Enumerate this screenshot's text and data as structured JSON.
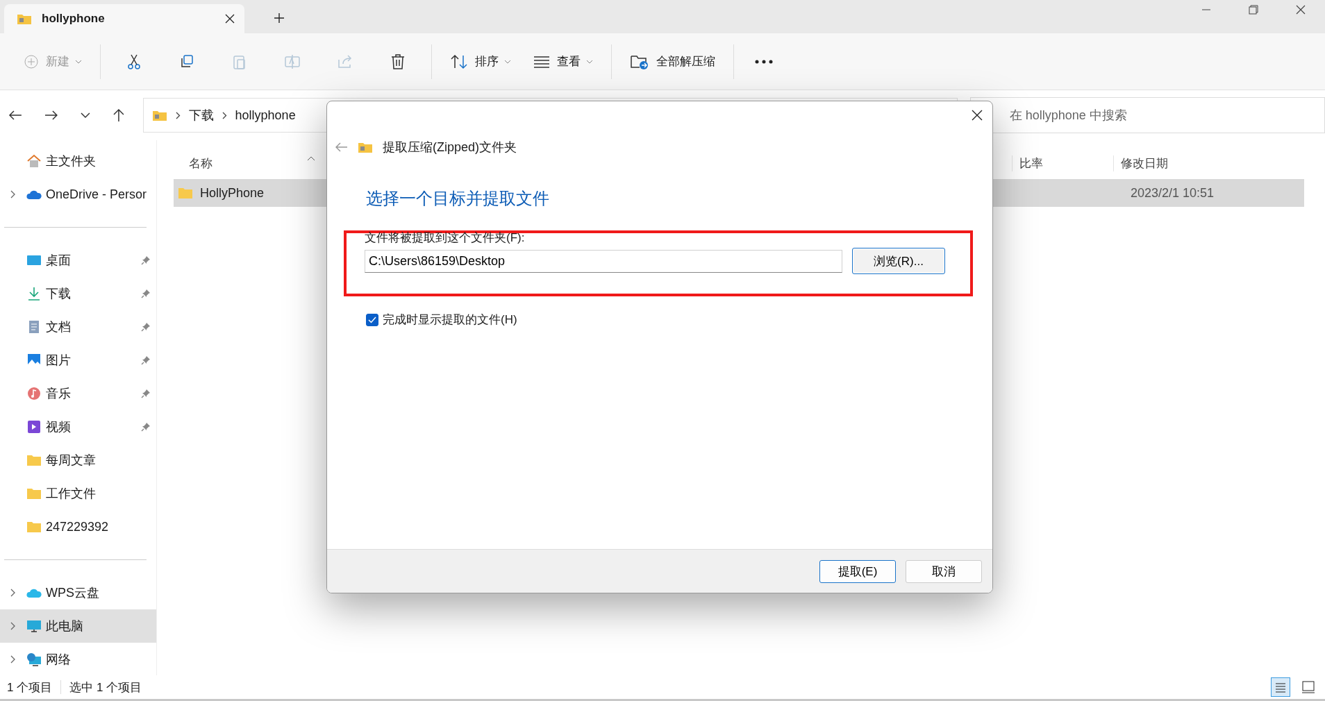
{
  "tab": {
    "title": "hollyphone"
  },
  "toolbar": {
    "new": {
      "label": "新建",
      "disabled": true
    },
    "actions": [
      {
        "kind": "cut",
        "disabled": false
      },
      {
        "kind": "copy",
        "disabled": false
      },
      {
        "kind": "paste",
        "disabled": true
      },
      {
        "kind": "rename",
        "disabled": true
      },
      {
        "kind": "share",
        "disabled": true
      },
      {
        "kind": "delete",
        "disabled": false
      }
    ],
    "sort": {
      "label": "排序"
    },
    "view": {
      "label": "查看"
    },
    "extract_all": {
      "label": "全部解压缩"
    }
  },
  "address": {
    "crumbs": [
      "下载",
      "hollyphone"
    ]
  },
  "search": {
    "placeholder": "在 hollyphone 中搜索"
  },
  "sidebar": {
    "groups": [
      [
        {
          "label": "主文件夹",
          "expandable": false,
          "pinned": false,
          "selected": false
        },
        {
          "label": "OneDrive - Persor",
          "expandable": true,
          "pinned": false,
          "selected": false
        }
      ],
      [
        {
          "label": "桌面",
          "expandable": false,
          "pinned": true,
          "selected": false
        },
        {
          "label": "下载",
          "expandable": false,
          "pinned": true,
          "selected": false
        },
        {
          "label": "文档",
          "expandable": false,
          "pinned": true,
          "selected": false
        },
        {
          "label": "图片",
          "expandable": false,
          "pinned": true,
          "selected": false
        },
        {
          "label": "音乐",
          "expandable": false,
          "pinned": true,
          "selected": false
        },
        {
          "label": "视频",
          "expandable": false,
          "pinned": true,
          "selected": false
        },
        {
          "label": "每周文章",
          "expandable": false,
          "pinned": false,
          "selected": false
        },
        {
          "label": "工作文件",
          "expandable": false,
          "pinned": false,
          "selected": false
        },
        {
          "label": "247229392",
          "expandable": false,
          "pinned": false,
          "selected": false
        }
      ],
      [
        {
          "label": "WPS云盘",
          "expandable": true,
          "pinned": false,
          "selected": false
        },
        {
          "label": "此电脑",
          "expandable": true,
          "pinned": false,
          "selected": true
        },
        {
          "label": "网络",
          "expandable": true,
          "pinned": false,
          "selected": false
        }
      ]
    ]
  },
  "table": {
    "columns": [
      "名称",
      "比率",
      "修改日期"
    ],
    "rows": [
      {
        "name": "HollyPhone",
        "date": "2023/2/1 10:51",
        "selected": true
      }
    ]
  },
  "status_bar": {
    "count": "1 个项目",
    "selection": "选中 1 个项目",
    "views": [
      {
        "kind": "details",
        "selected": true
      },
      {
        "kind": "tiles",
        "selected": false
      }
    ]
  },
  "dialog": {
    "title": "提取压缩(Zipped)文件夹",
    "heading": "选择一个目标并提取文件",
    "field_label": "文件将被提取到这个文件夹(F):",
    "path": "C:\\Users\\86159\\Desktop",
    "browse": "浏览(R)...",
    "show_files": {
      "label": "完成时显示提取的文件(H)",
      "checked": true
    },
    "buttons": [
      "提取(E)",
      "取消"
    ]
  }
}
